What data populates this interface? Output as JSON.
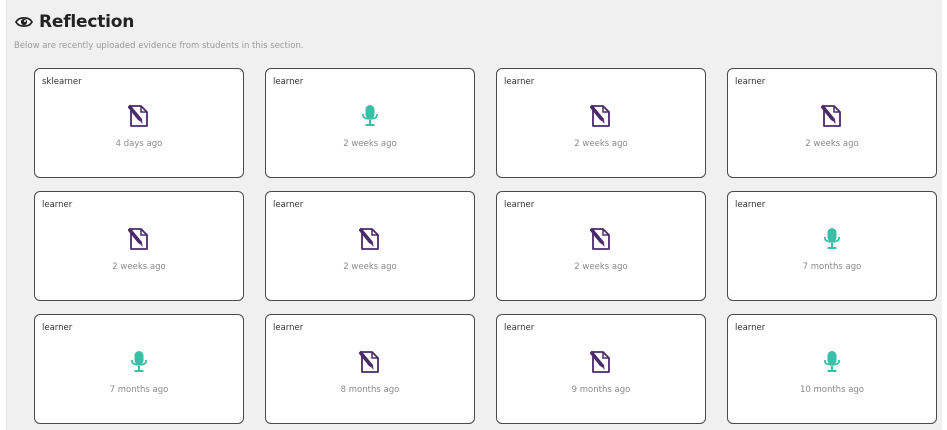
{
  "header": {
    "title": "Reflection",
    "subtitle": "Below are recently uploaded evidence from students in this section."
  },
  "colors": {
    "document_icon": "#4a2a6a",
    "mic_icon": "#3bbfa8"
  },
  "cards": [
    {
      "user": "sklearner",
      "time": "4 days ago",
      "type": "document-icon"
    },
    {
      "user": "learner",
      "time": "2 weeks ago",
      "type": "microphone-icon"
    },
    {
      "user": "learner",
      "time": "2 weeks ago",
      "type": "document-icon"
    },
    {
      "user": "learner",
      "time": "2 weeks ago",
      "type": "document-icon"
    },
    {
      "user": "learner",
      "time": "2 weeks ago",
      "type": "document-icon"
    },
    {
      "user": "learner",
      "time": "2 weeks ago",
      "type": "document-icon"
    },
    {
      "user": "learner",
      "time": "2 weeks ago",
      "type": "document-icon"
    },
    {
      "user": "learner",
      "time": "7 months ago",
      "type": "microphone-icon"
    },
    {
      "user": "learner",
      "time": "7 months ago",
      "type": "microphone-icon"
    },
    {
      "user": "learner",
      "time": "8 months ago",
      "type": "document-icon"
    },
    {
      "user": "learner",
      "time": "9 months ago",
      "type": "document-icon"
    },
    {
      "user": "learner",
      "time": "10 months ago",
      "type": "microphone-icon"
    }
  ]
}
